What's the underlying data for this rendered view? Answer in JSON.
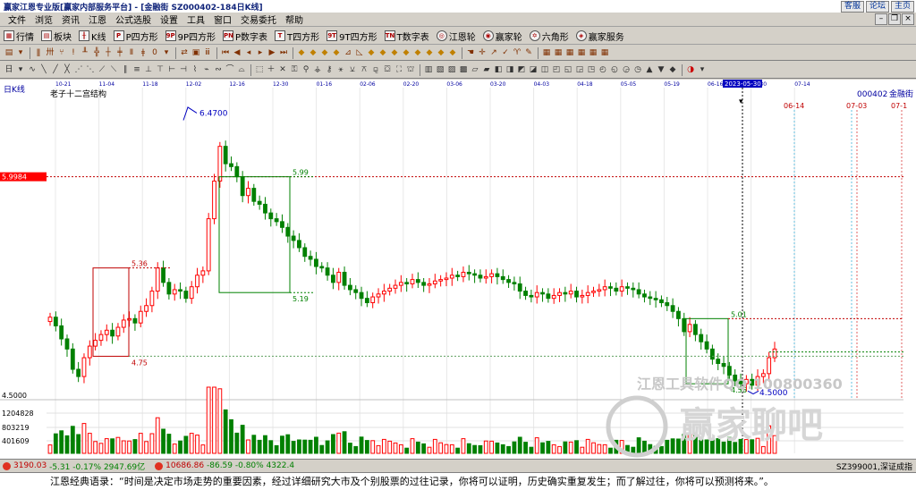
{
  "window": {
    "title": "赢家江恩专业版[赢家内部服务平台] - [金融街  SZ000402-184日K线]",
    "links": [
      "客服",
      "论坛",
      "主页"
    ]
  },
  "menu": [
    "文件",
    "浏览",
    "资讯",
    "江恩",
    "公式选股",
    "设置",
    "工具",
    "窗口",
    "交易委托",
    "帮助"
  ],
  "toolbar": [
    {
      "label": "行情",
      "icon": "grid-icon"
    },
    {
      "label": "板块",
      "icon": "blocks-icon"
    },
    {
      "label": "K线",
      "icon": "candle-icon"
    },
    {
      "label": "P四方形",
      "icon": "p-square-icon"
    },
    {
      "label": "9P四方形",
      "icon": "9p-square-icon"
    },
    {
      "label": "P数字表",
      "icon": "p-table-icon"
    },
    {
      "label": "T四方形",
      "icon": "t-square-icon"
    },
    {
      "label": "9T四方形",
      "icon": "9t-square-icon"
    },
    {
      "label": "T数字表",
      "icon": "t-table-icon"
    },
    {
      "label": "江恩轮",
      "icon": "gann-wheel-icon"
    },
    {
      "label": "赢家轮",
      "icon": "winner-wheel-icon"
    },
    {
      "label": "六角形",
      "icon": "hexagon-icon"
    },
    {
      "label": "赢家服务",
      "icon": "service-icon"
    }
  ],
  "chart_panel": {
    "period_label": "日K线",
    "structure_label": "老子十二宫结构",
    "stock_code": "000402",
    "stock_name": "金融街",
    "date_axis": [
      "10-21",
      "11-04",
      "11-18",
      "12-02",
      "12-16",
      "12-30",
      "01-16",
      "02-06",
      "02-20",
      "03-06",
      "03-20",
      "04-03",
      "04-18",
      "05-05",
      "05-19",
      "06-16",
      "06-30",
      "07-14"
    ],
    "cursor_date": "2023-05-30",
    "future_dates": [
      "06-14",
      "07-03",
      "07-1"
    ],
    "price_marker": "5.9984",
    "annotations": {
      "high": "6.4700",
      "low": "4.5000",
      "box1_top": "5.36",
      "box1_bottom": "4.75",
      "box2_top": "5.99",
      "box2_bottom": "5.19",
      "box3_top": "5.01",
      "box3_bottom": "4.56",
      "axis_low": "4.5000"
    },
    "volume_axis": [
      "1204828",
      "803219",
      "401609"
    ],
    "watermark_text": "江恩工具软件QQ:100800360",
    "watermark_logo": "赢家聊吧"
  },
  "chart_data": {
    "type": "candlestick",
    "title": "金融街 SZ000402 日K线",
    "ylim": [
      4.5,
      6.47
    ],
    "closes": [
      5.02,
      4.96,
      4.87,
      4.8,
      4.66,
      4.61,
      4.74,
      4.82,
      4.86,
      4.9,
      4.93,
      4.89,
      4.95,
      5.0,
      5.01,
      4.98,
      5.06,
      5.1,
      5.2,
      5.36,
      5.26,
      5.18,
      5.21,
      5.2,
      5.15,
      5.23,
      5.31,
      5.34,
      5.7,
      5.96,
      6.2,
      6.08,
      6.06,
      5.99,
      5.86,
      5.91,
      5.82,
      5.8,
      5.74,
      5.7,
      5.68,
      5.64,
      5.58,
      5.55,
      5.5,
      5.44,
      5.42,
      5.37,
      5.36,
      5.31,
      5.26,
      5.33,
      5.24,
      5.21,
      5.19,
      5.15,
      5.12,
      5.16,
      5.18,
      5.2,
      5.22,
      5.24,
      5.26,
      5.25,
      5.28,
      5.26,
      5.24,
      5.25,
      5.27,
      5.28,
      5.29,
      5.31,
      5.3,
      5.33,
      5.32,
      5.31,
      5.29,
      5.3,
      5.32,
      5.3,
      5.28,
      5.26,
      5.25,
      5.2,
      5.17,
      5.16,
      5.19,
      5.18,
      5.15,
      5.17,
      5.19,
      5.18,
      5.2,
      5.16,
      5.17,
      5.19,
      5.2,
      5.21,
      5.23,
      5.22,
      5.2,
      5.23,
      5.22,
      5.21,
      5.18,
      5.16,
      5.15,
      5.14,
      5.12,
      5.1,
      5.06,
      5.01,
      4.92,
      4.97,
      4.9,
      4.85,
      4.8,
      4.73,
      4.7,
      4.68,
      4.62,
      4.58,
      4.56,
      4.59,
      4.55,
      4.61,
      4.63,
      4.74,
      4.8
    ]
  },
  "statusbar": {
    "index1": "3190.03",
    "index1_chg": "-5.31 -0.17% 2947.69亿",
    "index2": "10686.86",
    "index2_chg": "-86.59 -0.80% 4322.4",
    "right": "SZ399001,深证成指"
  },
  "footer": {
    "quote": "江恩经典语录：“时间是决定市场走势的重要因素，经过详细研究大市及个别股票的过往记录，你将可以证明，历史确实重复发生；而了解过往，你将可以预测将来。”。"
  },
  "colors": {
    "up": "#ff0000",
    "down": "#008000",
    "grid": "#c0c0c0",
    "axis_text": "#0000a0",
    "marker_bg": "#ff0000"
  }
}
